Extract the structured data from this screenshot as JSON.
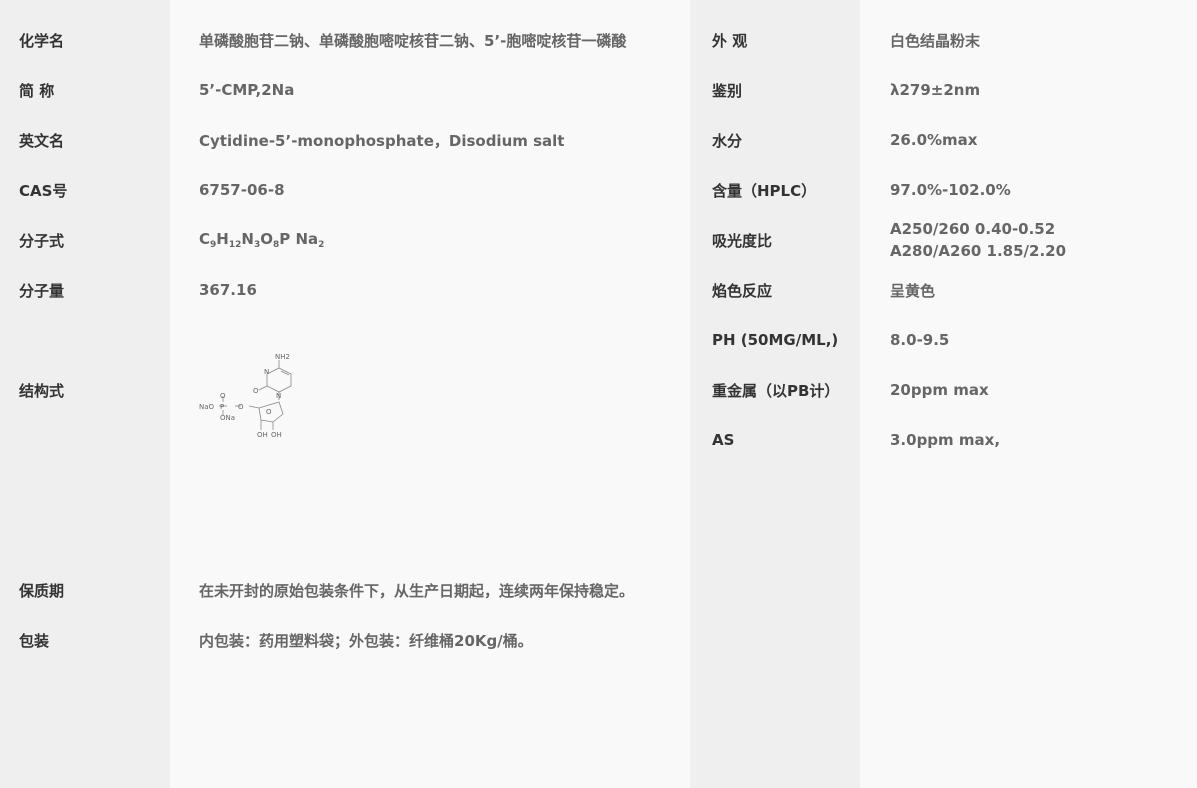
{
  "left": {
    "rows": [
      {
        "label": "化学名",
        "value": "单磷酸胞苷二钠、单磷酸胞嘧啶核苷二钠、5’-胞嘧啶核苷一磷酸"
      },
      {
        "label": "简 称",
        "value": "5’-CMP,2Na"
      },
      {
        "label": "英文名",
        "value": "Cytidine-5’-monophosphate，Disodium salt"
      },
      {
        "label": "CAS号",
        "value": "6757-06-8"
      },
      {
        "label": "分子式",
        "formula": {
          "c": "C",
          "c_n": "9",
          "h": "H",
          "h_n": "12",
          "n": "N",
          "n_n": "3",
          "o": "O",
          "o_n": "8",
          "p": "P Na",
          "na_n": "2"
        }
      },
      {
        "label": "分子量",
        "value": "367.16"
      },
      {
        "label": "结构式"
      },
      {
        "label": "保质期",
        "value": "在未开封的原始包装条件下，从生产日期起，连续两年保持稳定。"
      },
      {
        "label": "包装",
        "value": "内包装：药用塑料袋；外包装：纤维桶20Kg/桶。"
      }
    ],
    "structure": {
      "nh2": "NH2",
      "n": "N",
      "o_carbonyl": "O",
      "nao": "NaO",
      "p": "P",
      "ona": "ONa",
      "o": "O",
      "oh1": "OH",
      "oh2": "OH"
    }
  },
  "right": {
    "rows": [
      {
        "label": "外 观",
        "value": "白色结晶粉末"
      },
      {
        "label": "鉴别",
        "value": "λ279±2nm"
      },
      {
        "label": "水分",
        "value": "26.0%max"
      },
      {
        "label": "含量（HPLC）",
        "value": "97.0%-102.0%"
      },
      {
        "label": "吸光度比",
        "value_line1": "A250/260 0.40-0.52",
        "value_line2": "A280/A260 1.85/2.20"
      },
      {
        "label": "焰色反应",
        "value": "呈黄色"
      },
      {
        "label": "PH (50MG/ML,)",
        "value": "8.0-9.5"
      },
      {
        "label": "重金属（以PB计）",
        "value": "20ppm max"
      },
      {
        "label": "AS",
        "value": "3.0ppm max,"
      }
    ]
  }
}
